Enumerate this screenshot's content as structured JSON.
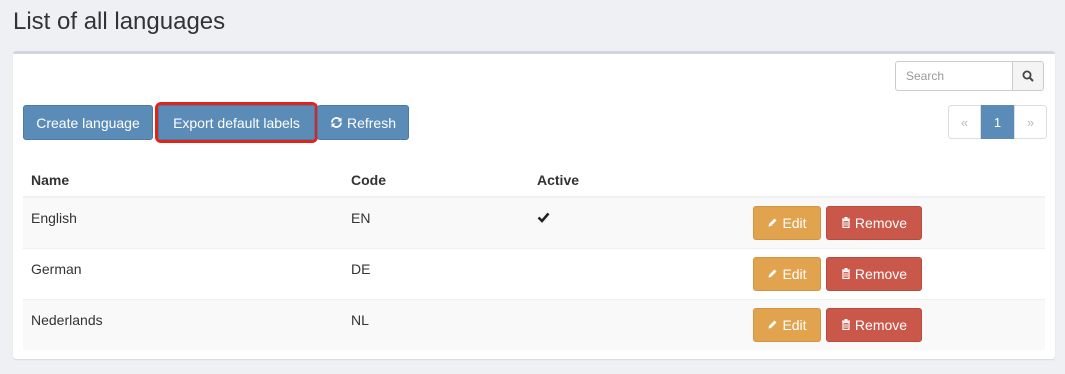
{
  "page": {
    "title": "List of all languages"
  },
  "search": {
    "placeholder": "Search",
    "icon": "search-icon"
  },
  "toolbar": {
    "create_label": "Create language",
    "export_label": "Export default labels",
    "refresh_label": "Refresh"
  },
  "pagination": {
    "prev": "«",
    "current": "1",
    "next": "»"
  },
  "table": {
    "headers": {
      "name": "Name",
      "code": "Code",
      "active": "Active"
    },
    "rows": [
      {
        "name": "English",
        "code": "EN",
        "active": true,
        "edit": "Edit",
        "remove": "Remove"
      },
      {
        "name": "German",
        "code": "DE",
        "active": false,
        "edit": "Edit",
        "remove": "Remove"
      },
      {
        "name": "Nederlands",
        "code": "NL",
        "active": false,
        "edit": "Edit",
        "remove": "Remove"
      }
    ]
  },
  "colors": {
    "primary": "#5b8cb8",
    "warning": "#e1a34d",
    "danger": "#c9574a",
    "highlight": "#e2231a"
  }
}
